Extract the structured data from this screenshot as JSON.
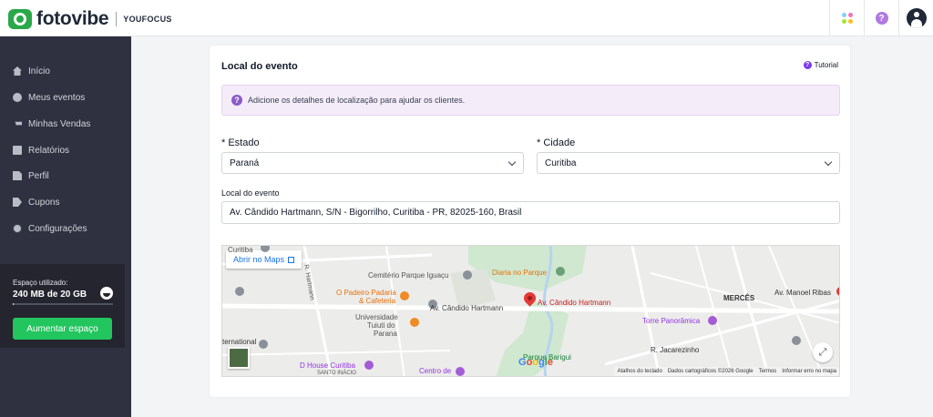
{
  "header": {
    "brand": "fotovibe",
    "sub_brand": "YOUFOCUS",
    "apps_icon_colors": [
      "#7dd3fc",
      "#f472b6",
      "#a3e635",
      "#fbbf24"
    ],
    "help_glyph": "?"
  },
  "sidebar": {
    "items": [
      {
        "label": "Início",
        "icon": "home-icon"
      },
      {
        "label": "Meus eventos",
        "icon": "events-icon"
      },
      {
        "label": "Minhas Vendas",
        "icon": "cart-icon"
      },
      {
        "label": "Relatórios",
        "icon": "chart-icon"
      },
      {
        "label": "Perfil",
        "icon": "file-icon"
      },
      {
        "label": "Cupons",
        "icon": "tag-icon"
      },
      {
        "label": "Configurações",
        "icon": "gear-icon"
      }
    ],
    "storage": {
      "label": "Espaço utilizado:",
      "value": "240 MB de 20 GB",
      "used_fraction": 0.012,
      "button": "Aumentar espaço"
    }
  },
  "form": {
    "title": "Local do evento",
    "tutorial": "Tutorial",
    "info": "Adicione os detalhes de localização para ajudar os clientes.",
    "estado_label": "* Estado",
    "estado_value": "Paraná",
    "cidade_label": "* Cidade",
    "cidade_value": "Curitiba",
    "local_label": "Local do evento",
    "local_value": "Av. Cândido Hartmann, S/N - Bigorrilho, Curitiba - PR, 82025-160, Brasil"
  },
  "map": {
    "open_maps": "Abrir no Maps",
    "labels": {
      "cemiterio": "Cemitério Parque Iguaçu",
      "diaria": "Diaria no Parque",
      "padeiro1": "O Padeiro Padaria",
      "padeiro2": "& Cafeteria",
      "avenida": "Av. Cândido Hartmann",
      "pin_label": "Av. Cândido Hartmann",
      "univ1": "Universidade",
      "univ2": "Tuiuti do",
      "univ3": "Parana",
      "torre": "Torre Panorâmica",
      "merces": "MERCÊS",
      "manoel": "Av. Manoel Ribas",
      "jacarezinho": "R. Jacarezinho",
      "house": "D House Curitiba",
      "centro": "Centro de",
      "parque": "Parque Barigui",
      "curitiba_top": "Curitiba",
      "hartmann_vert": "R. Hartmann",
      "intl": "ternational",
      "santo": "SANTO INÁCIO"
    },
    "google_letters": [
      "G",
      "o",
      "o",
      "g",
      "l",
      "e"
    ],
    "fullscreen_glyph": "⤢",
    "attribution": [
      "Atalhos do teclado",
      "Dados cartográficos ©2026 Google",
      "Termos",
      "Informar erro no mapa"
    ]
  }
}
